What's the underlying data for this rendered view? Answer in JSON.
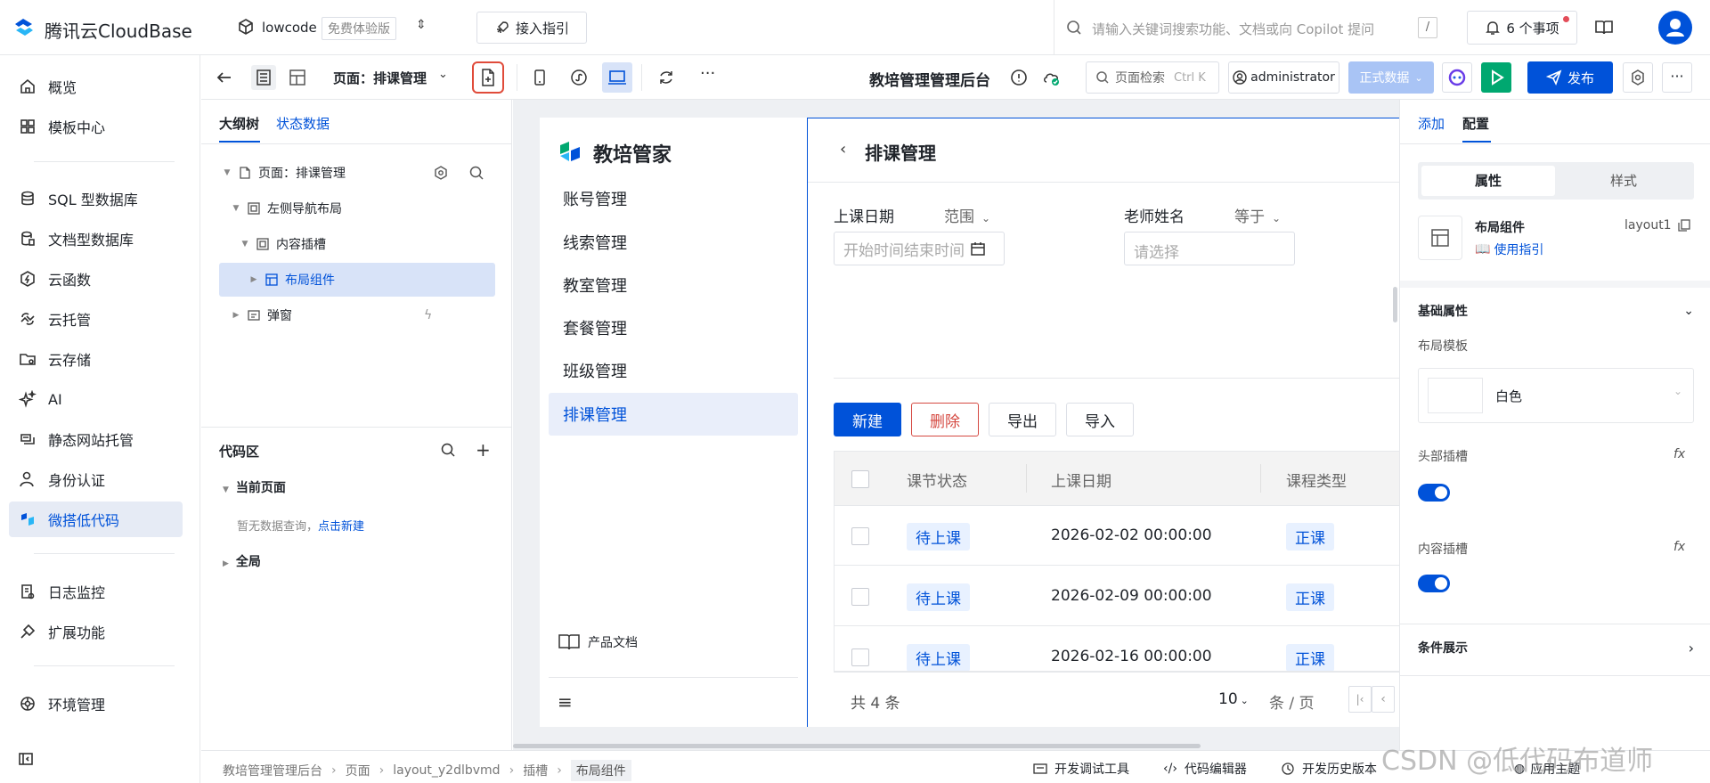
{
  "brand": {
    "title": "腾讯云CloudBase",
    "env_name": "lowcode",
    "env_badge": "免费体验版"
  },
  "topbar": {
    "guide_label": "接入指引",
    "search_placeholder": "请输入关键词搜索功能、文档或向 Copilot 提问",
    "search_shortcut": "/",
    "todo_label": "6 个事项"
  },
  "leftnav": {
    "items": [
      {
        "label": "概览",
        "icon": "home-icon"
      },
      {
        "label": "模板中心",
        "icon": "grid-icon"
      },
      {
        "label": "SQL 型数据库",
        "icon": "database-icon"
      },
      {
        "label": "文档型数据库",
        "icon": "database-doc-icon"
      },
      {
        "label": "云函数",
        "icon": "function-icon"
      },
      {
        "label": "云托管",
        "icon": "cloud-run-icon"
      },
      {
        "label": "云存储",
        "icon": "folder-icon"
      },
      {
        "label": "AI",
        "icon": "sparkle-icon"
      },
      {
        "label": "静态网站托管",
        "icon": "web-hosting-icon"
      },
      {
        "label": "身份认证",
        "icon": "user-auth-icon"
      },
      {
        "label": "微搭低代码",
        "icon": "weda-icon"
      },
      {
        "label": "日志监控",
        "icon": "log-icon"
      },
      {
        "label": "扩展功能",
        "icon": "extension-icon"
      },
      {
        "label": "环境管理",
        "icon": "env-icon"
      }
    ]
  },
  "editor": {
    "page_selector": "页面：排课管理",
    "app_title": "教培管理管理后台",
    "page_search_placeholder": "页面检索",
    "page_search_shortcut": "Ctrl K",
    "user": "administrator",
    "data_mode": "正式数据",
    "publish_label": "发布"
  },
  "outline": {
    "tabs": [
      "大纲树",
      "状态数据"
    ],
    "tree": [
      {
        "label": "页面：排课管理"
      },
      {
        "label": "左侧导航布局"
      },
      {
        "label": "内容插槽"
      },
      {
        "label": "布局组件"
      },
      {
        "label": "弹窗"
      }
    ],
    "code_title": "代码区",
    "current_page": "当前页面",
    "empty_text": "暂无数据查询，",
    "empty_link": "点击新建",
    "global": "全局"
  },
  "preview": {
    "app_name": "教培管家",
    "menu": [
      "账号管理",
      "线索管理",
      "教室管理",
      "套餐管理",
      "班级管理",
      "排课管理"
    ],
    "doc_link": "产品文档",
    "page_title": "排课管理",
    "filter1_label": "上课日期",
    "filter1_op": "范围",
    "filter1_placeholder": "开始时间结束时间",
    "filter2_label": "老师姓名",
    "filter2_op": "等于",
    "filter2_placeholder": "请选择",
    "buttons": {
      "new": "新建",
      "delete": "删除",
      "export": "导出",
      "import": "导入"
    },
    "columns": [
      "课节状态",
      "上课日期",
      "课程类型"
    ],
    "rows": [
      {
        "status": "待上课",
        "date": "2026-02-02 00:00:00",
        "type": "正课"
      },
      {
        "status": "待上课",
        "date": "2026-02-09 00:00:00",
        "type": "正课"
      },
      {
        "status": "待上课",
        "date": "2026-02-16 00:00:00",
        "type": "正课"
      }
    ],
    "total": "共 4 条",
    "page_size": "10",
    "page_size_unit": "条 / 页"
  },
  "props": {
    "tabs": [
      "添加",
      "配置"
    ],
    "segments": [
      "属性",
      "样式"
    ],
    "component_name": "布局组件",
    "component_id": "layout1",
    "usage_link": "使用指引",
    "section_basic": "基础属性",
    "layout_template_label": "布局模板",
    "layout_template_value": "白色",
    "header_slot_label": "头部插槽",
    "content_slot_label": "内容插槽",
    "section_condition": "条件展示",
    "fx": "fx"
  },
  "bottombar": {
    "breadcrumb": [
      "教培管理管理后台",
      "页面",
      "layout_y2dlbvmd",
      "插槽",
      "布局组件"
    ],
    "devtools": "开发调试工具",
    "code_editor": "代码编辑器",
    "history": "开发历史版本",
    "app_theme": "应用主题",
    "watermark": "CSDN @低代码布道师"
  },
  "colors": {
    "primary": "#0052d9",
    "green": "#00a870",
    "red": "#d54941",
    "active_bg": "#e6ebf5"
  }
}
